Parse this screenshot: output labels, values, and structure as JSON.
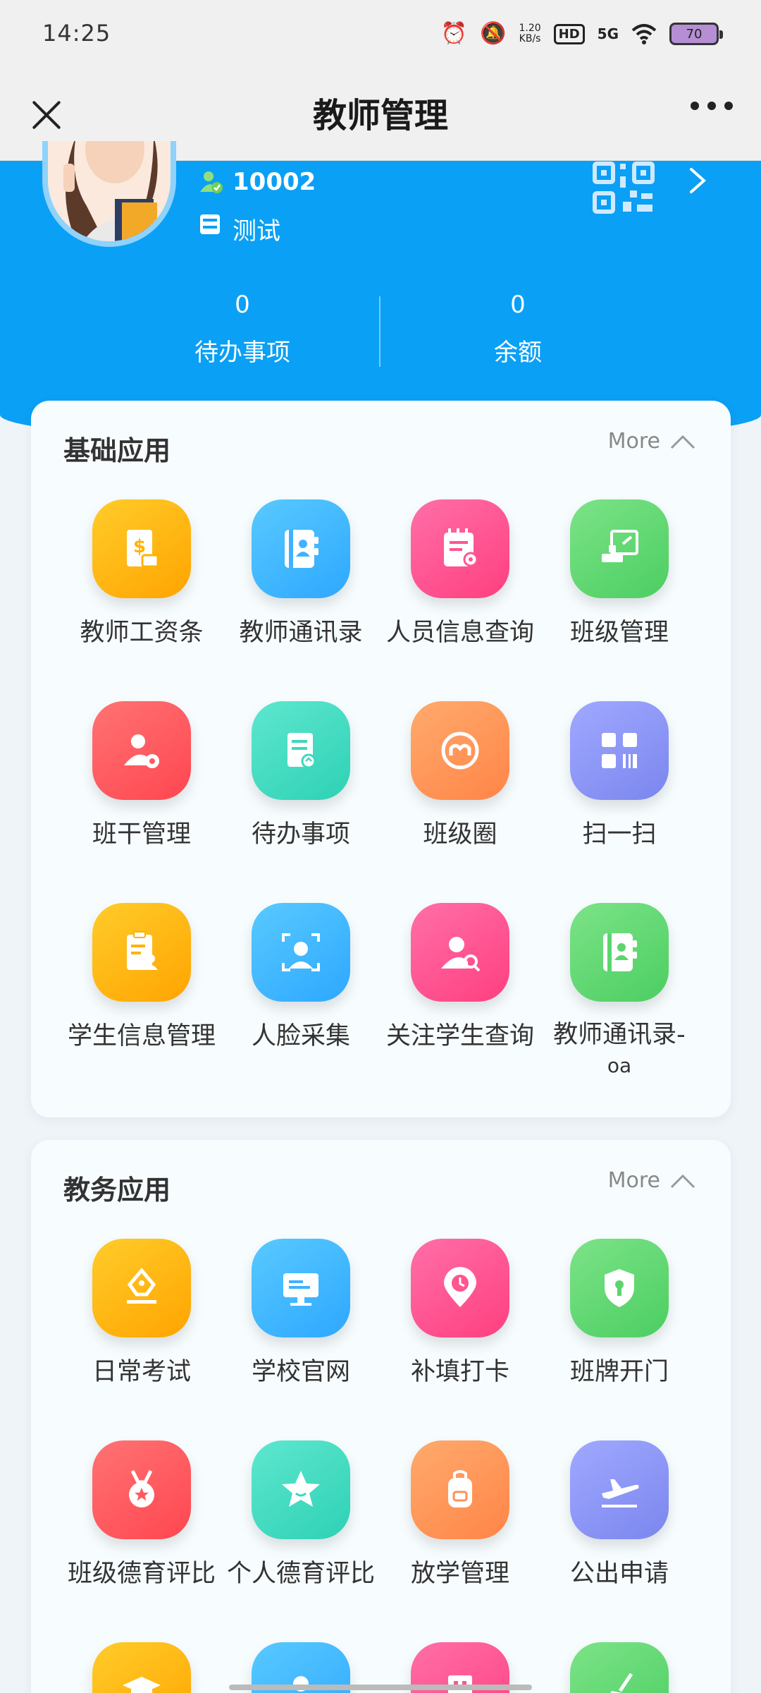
{
  "status_bar": {
    "time": "14:25",
    "speed_top": "1.20",
    "speed_bottom": "KB/s",
    "hd": "HD",
    "network": "5G",
    "battery": "70"
  },
  "title_bar": {
    "title": "教师管理"
  },
  "profile": {
    "user_id": "10002",
    "name": "测试"
  },
  "stats": [
    {
      "value": "0",
      "label": "待办事项"
    },
    {
      "value": "0",
      "label": "余额"
    }
  ],
  "sections": [
    {
      "title": "基础应用",
      "more_label": "More",
      "apps": [
        {
          "label": "教师工资条",
          "icon": "salary-slip-icon",
          "color": "orange"
        },
        {
          "label": "教师通讯录",
          "icon": "contacts-book-icon",
          "color": "blue"
        },
        {
          "label": "人员信息查询",
          "icon": "info-search-icon",
          "color": "pink"
        },
        {
          "label": "班级管理",
          "icon": "class-manage-icon",
          "color": "green"
        },
        {
          "label": "班干管理",
          "icon": "cadre-manage-icon",
          "color": "red"
        },
        {
          "label": "待办事项",
          "icon": "todo-doc-icon",
          "color": "teal"
        },
        {
          "label": "班级圈",
          "icon": "class-circle-icon",
          "color": "peach"
        },
        {
          "label": "扫一扫",
          "icon": "scan-icon",
          "color": "purple"
        },
        {
          "label": "学生信息管理",
          "icon": "student-clipboard-icon",
          "color": "orange"
        },
        {
          "label": "人脸采集",
          "icon": "face-capture-icon",
          "color": "blue"
        },
        {
          "label": "关注学生查询",
          "icon": "person-search-icon",
          "color": "pink"
        },
        {
          "label": "教师通讯录-oa",
          "icon": "contacts-book-icon",
          "color": "green",
          "label_line1": "教师通讯录-",
          "label_line2": "oa"
        }
      ]
    },
    {
      "title": "教务应用",
      "more_label": "More",
      "apps": [
        {
          "label": "日常考试",
          "icon": "pen-nib-icon",
          "color": "orange"
        },
        {
          "label": "学校官网",
          "icon": "monitor-icon",
          "color": "blue"
        },
        {
          "label": "补填打卡",
          "icon": "location-clock-icon",
          "color": "pink"
        },
        {
          "label": "班牌开门",
          "icon": "shield-key-icon",
          "color": "green"
        },
        {
          "label": "班级德育评比",
          "icon": "medal-icon",
          "color": "red"
        },
        {
          "label": "个人德育评比",
          "icon": "star-icon",
          "color": "teal"
        },
        {
          "label": "放学管理",
          "icon": "backpack-icon",
          "color": "peach"
        },
        {
          "label": "公出申请",
          "icon": "airplane-icon",
          "color": "purple"
        }
      ]
    }
  ]
}
